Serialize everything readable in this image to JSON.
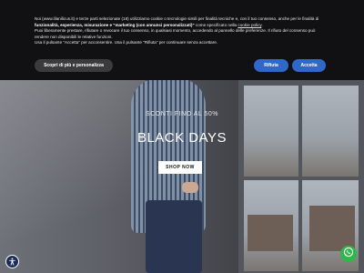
{
  "cookie_banner": {
    "line1_start": "Noi (www.lilanilicus.it) e terze parti selezionate (18) utilizziamo cookie o tecnologie simili per finalità tecniche e, con il tuo consenso, anche per le finalità di",
    "line2_bold": "funzionalità, esperienza, misurazione e \"marketing (con annunci personalizzati)\"",
    "line2_rest": " come specificato nella ",
    "policy_link": "cookie policy",
    "line2_end": ".",
    "line3": "Puoi liberamente prestare, rifiutare o revocare il tuo consenso, in qualsiasi momento, accedendo al pannello delle preferenze. Il rifiuto del consenso può",
    "line4": "rendere non disponibili le relative funzioni.",
    "line5": "Usa il pulsante \"Accetta\" per acconsentire. Usa il pulsante \"Rifiuta\" per continuare senza accettare.",
    "prefs_label": "Scopri di più e personalizza",
    "reject_label": "Rifiuta",
    "accept_label": "Accetta"
  },
  "hero": {
    "subtitle": "SCONTI FINO AL 50%",
    "title": "BLACK DAYS",
    "cta_label": "SHOP NOW"
  },
  "icons": {
    "accessibility": "accessibility-icon",
    "whatsapp": "whatsapp-icon"
  },
  "colors": {
    "banner_bg": "#111114",
    "accent_blue": "#2f68c8",
    "whatsapp_green": "#2fb84a"
  }
}
